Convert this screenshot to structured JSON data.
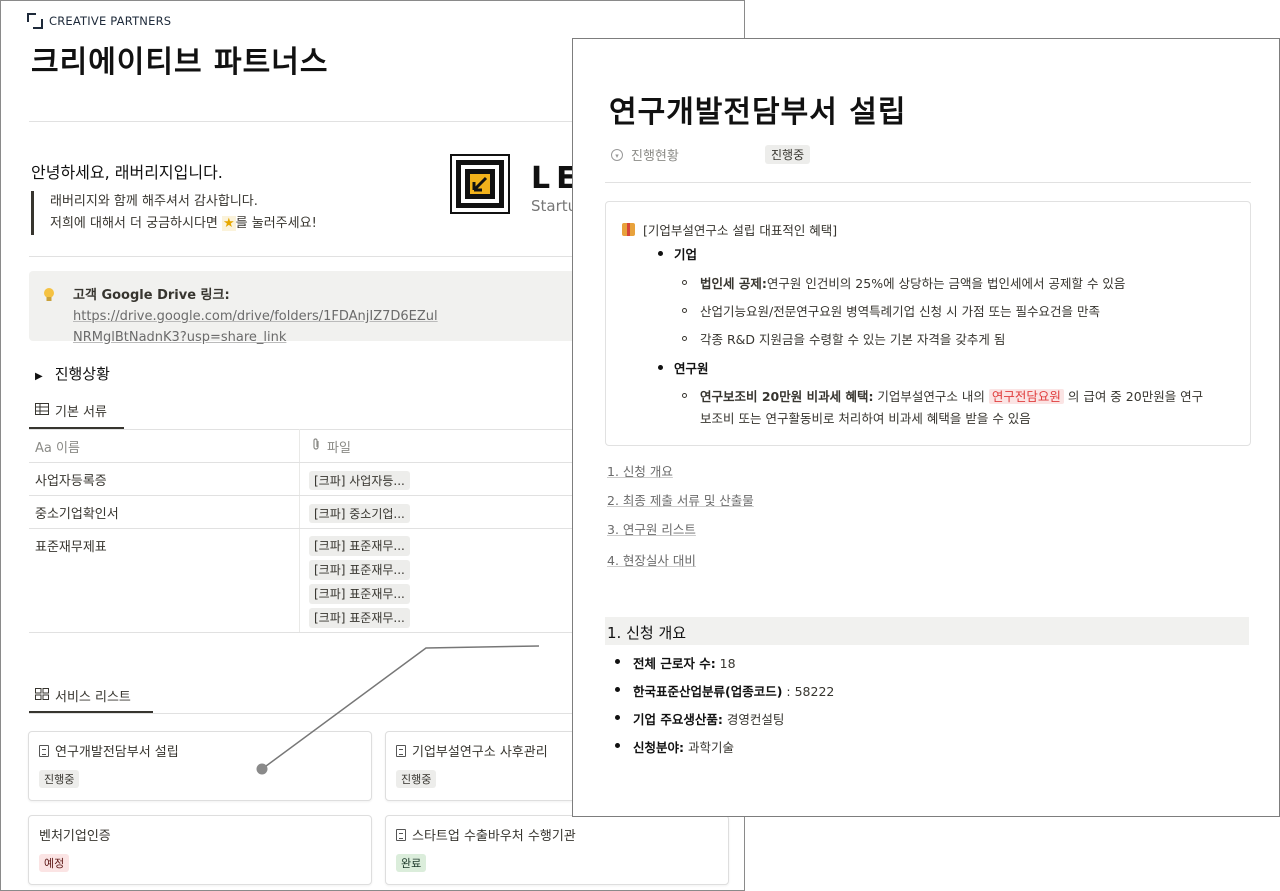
{
  "back": {
    "brand": "CREATIVE PARTNERS",
    "title": "크리에이티브 파트너스",
    "greeting": "안녕하세요, 래버리지입니다.",
    "quote_line1": "래버리지와 함께 해주셔서 감사합니다.",
    "quote_line2_pre": "저희에 대해서 더 궁금하시다면 ",
    "quote_line2_star": "★",
    "quote_line2_post": "를 눌러주세요!",
    "logo_text": "LE",
    "logo_sub": "Startu",
    "callout_icon": "lightbulb-icon",
    "callout_label": "고객 Google Drive 링크:",
    "callout_link1": "https://drive.google.com/drive/folders/1FDAnjIZ7D6EZul",
    "callout_link2": "NRMglBtNadnK3?usp=share_link",
    "toggle_label": "진행상황",
    "tab1_label": "기본 서류",
    "col_name": "이름",
    "col_name_prefix": "Aa",
    "col_file": "파일",
    "rows": [
      {
        "name": "사업자등록증",
        "files": [
          "[크파] 사업자등..."
        ]
      },
      {
        "name": "중소기업확인서",
        "files": [
          "[크파] 중소기업..."
        ]
      },
      {
        "name": "표준재무제표",
        "files": [
          "[크파] 표준재무...",
          "[크파] 표준재무...",
          "[크파] 표준재무...",
          "[크파] 표준재무..."
        ]
      }
    ],
    "tab2_label": "서비스 리스트",
    "cards": [
      {
        "title": "연구개발전담부서 설립",
        "tag": "진행중",
        "tag_bg": "#ededeb",
        "tag_fg": "#37352f",
        "icon": "page-icon"
      },
      {
        "title": "기업부설연구소 사후관리",
        "tag": "진행중",
        "tag_bg": "#ededeb",
        "tag_fg": "#37352f",
        "icon": "page-icon"
      },
      {
        "title": "벤처기업인증",
        "tag": "예정",
        "tag_bg": "#fbe4e4",
        "tag_fg": "#5d1715",
        "icon": ""
      },
      {
        "title": "스타트업 수출바우처 수행기관",
        "tag": "완료",
        "tag_bg": "#dbeddb",
        "tag_fg": "#1c3829",
        "icon": "page-icon"
      }
    ]
  },
  "front": {
    "title": "연구개발전담부서 설립",
    "prop_label": "진행현황",
    "prop_value": "진행중",
    "box_title": "[기업부설연구소 설립 대표적인 혜택]",
    "b_company": "기업",
    "c1_bold": "법인세 공제:",
    "c1_text": "연구원 인건비의 25%에 상당하는 금액을 법인세에서 공제할 수 있음",
    "c2_text": "산업기능요원/전문연구요원 병역특례기업 신청 시 가점 또는 필수요건을 만족",
    "c3_text": "각종 R&D 지원금을 수령할 수 있는 기본 자격을 갖추게 됨",
    "b_researcher": "연구원",
    "r1_bold": "연구보조비 20만원 비과세 혜택:",
    "r1_text_a": " 기업부설연구소 내의 ",
    "r1_tag": "연구전담요원",
    "r1_text_b": " 의 급여 중 20만원을 연구",
    "r1_text_c": "보조비 또는 연구활동비로 처리하여 비과세 혜택을 받을 수 있음",
    "toc": [
      "1. 신청 개요",
      "2. 최종 제출 서류 및 산출물",
      "3. 연구원 리스트",
      "4. 현장실사 대비"
    ],
    "section_title": "1. 신청 개요",
    "facts": [
      {
        "label": "전체 근로자 수:",
        "value": " 18"
      },
      {
        "label": "한국표준산업분류(업종코드)",
        "value": " : 58222"
      },
      {
        "label": "기업 주요생산품:",
        "value": " 경영컨설팅"
      },
      {
        "label": "신청분야:",
        "value": " 과학기술"
      }
    ]
  }
}
